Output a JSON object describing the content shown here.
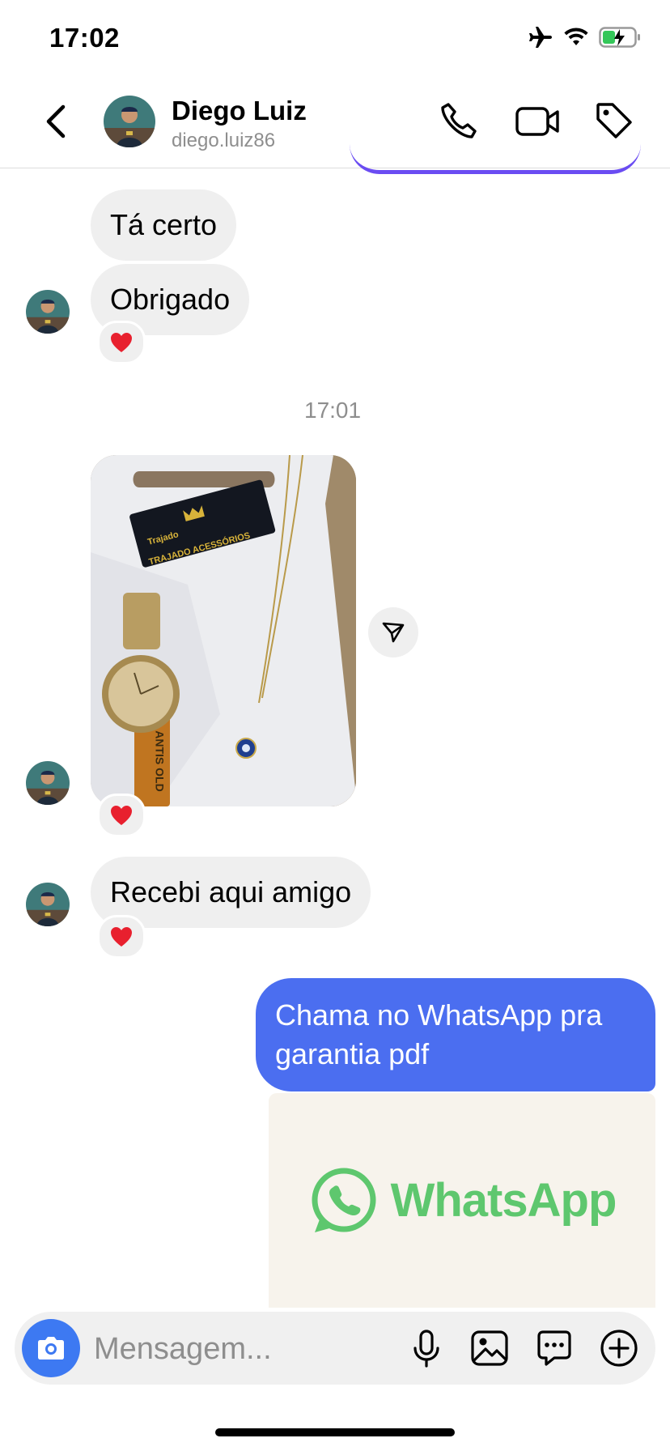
{
  "status_bar": {
    "time": "17:02"
  },
  "header": {
    "name": "Diego Luiz",
    "username": "diego.luiz86"
  },
  "messages": {
    "msg1": "Tá certo",
    "msg2": "Obrigado",
    "timestamp": "17:01",
    "msg4": "Recebi aqui amigo",
    "sent1": "Chama no WhatsApp pra garantia pdf"
  },
  "photo": {
    "card_brand": "Trajado",
    "card_text": "TRAJADO ACESSÓRIOS",
    "tag_text": "ANTIS OLD"
  },
  "whatsapp_card": {
    "brand": "WhatsApp"
  },
  "composer": {
    "placeholder": "Mensagem..."
  },
  "reactions": {
    "emoji": "❤️"
  },
  "colors": {
    "accent": "#3d79f2",
    "sent_bubble": "#4b6ef0",
    "received_bubble": "#efefef",
    "whatsapp_green": "#5ec76e"
  }
}
